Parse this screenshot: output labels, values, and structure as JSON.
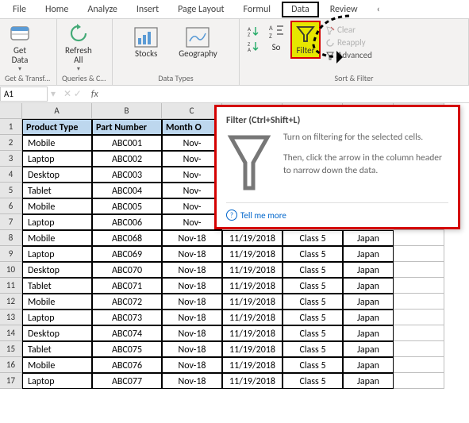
{
  "tabs": [
    "File",
    "Home",
    "Analyze",
    "Insert",
    "Page Layout",
    "Formul",
    "Data",
    "Review",
    "‹"
  ],
  "activeTab": "Data",
  "ribbon": {
    "getData": {
      "label": "Get\nData",
      "group": "Get & Transform..."
    },
    "refresh": {
      "label": "Refresh\nAll",
      "group": "Queries & Co..."
    },
    "stocks": {
      "label": "Stocks"
    },
    "geography": {
      "label": "Geography"
    },
    "dataTypesGroup": "Data Types",
    "sortAZ": "A→Z",
    "sortZA": "Z→A",
    "sort": "So",
    "filter": "Filter",
    "clear": "Clear",
    "reapply": "Reapply",
    "advanced": "Advanced",
    "sortFilterGroup": "Sort & Filter"
  },
  "nameBox": "A1",
  "fx": "fx",
  "tooltip": {
    "title": "Filter (Ctrl+Shift+L)",
    "line1": "Turn on filtering for the selected cells.",
    "line2": "Then, click the arrow in the column header to narrow down the data.",
    "link": "Tell me more"
  },
  "columns": {
    "letters": [
      "A",
      "B",
      "C",
      "",
      "",
      "",
      ""
    ],
    "widths": [
      88,
      88,
      76,
      76,
      76,
      64,
      64
    ]
  },
  "headers": [
    "Product Type",
    "Part Number",
    "Month O",
    "",
    "",
    "",
    ""
  ],
  "rows": [
    {
      "n": 2,
      "c": [
        "Mobile",
        "ABC001",
        "Nov-",
        "",
        "",
        "",
        ""
      ]
    },
    {
      "n": 3,
      "c": [
        "Laptop",
        "ABC002",
        "Nov-",
        "",
        "",
        "",
        ""
      ]
    },
    {
      "n": 4,
      "c": [
        "Desktop",
        "ABC003",
        "Nov-",
        "",
        "",
        "",
        ""
      ]
    },
    {
      "n": 5,
      "c": [
        "Tablet",
        "ABC004",
        "Nov-",
        "",
        "",
        "",
        ""
      ]
    },
    {
      "n": 6,
      "c": [
        "Mobile",
        "ABC005",
        "Nov-",
        "",
        "",
        "",
        ""
      ]
    },
    {
      "n": 7,
      "c": [
        "Laptop",
        "ABC006",
        "Nov-",
        "",
        "",
        "",
        ""
      ]
    },
    {
      "n": 8,
      "c": [
        "Mobile",
        "ABC068",
        "Nov-18",
        "11/19/2018",
        "Class 5",
        "Japan",
        ""
      ]
    },
    {
      "n": 9,
      "c": [
        "Laptop",
        "ABC069",
        "Nov-18",
        "11/19/2018",
        "Class 5",
        "Japan",
        ""
      ]
    },
    {
      "n": 10,
      "c": [
        "Desktop",
        "ABC070",
        "Nov-18",
        "11/19/2018",
        "Class 5",
        "Japan",
        ""
      ]
    },
    {
      "n": 11,
      "c": [
        "Tablet",
        "ABC071",
        "Nov-18",
        "11/19/2018",
        "Class 5",
        "Japan",
        ""
      ]
    },
    {
      "n": 12,
      "c": [
        "Mobile",
        "ABC072",
        "Nov-18",
        "11/19/2018",
        "Class 5",
        "Japan",
        ""
      ]
    },
    {
      "n": 13,
      "c": [
        "Laptop",
        "ABC073",
        "Nov-18",
        "11/19/2018",
        "Class 5",
        "Japan",
        ""
      ]
    },
    {
      "n": 14,
      "c": [
        "Desktop",
        "ABC074",
        "Nov-18",
        "11/19/2018",
        "Class 5",
        "Japan",
        ""
      ]
    },
    {
      "n": 15,
      "c": [
        "Tablet",
        "ABC075",
        "Nov-18",
        "11/19/2018",
        "Class 5",
        "Japan",
        ""
      ]
    },
    {
      "n": 16,
      "c": [
        "Mobile",
        "ABC076",
        "Nov-18",
        "11/19/2018",
        "Class 5",
        "Japan",
        ""
      ]
    },
    {
      "n": 17,
      "c": [
        "Laptop",
        "ABC077",
        "Nov-18",
        "11/19/2018",
        "Class 5",
        "Japan",
        ""
      ]
    }
  ]
}
